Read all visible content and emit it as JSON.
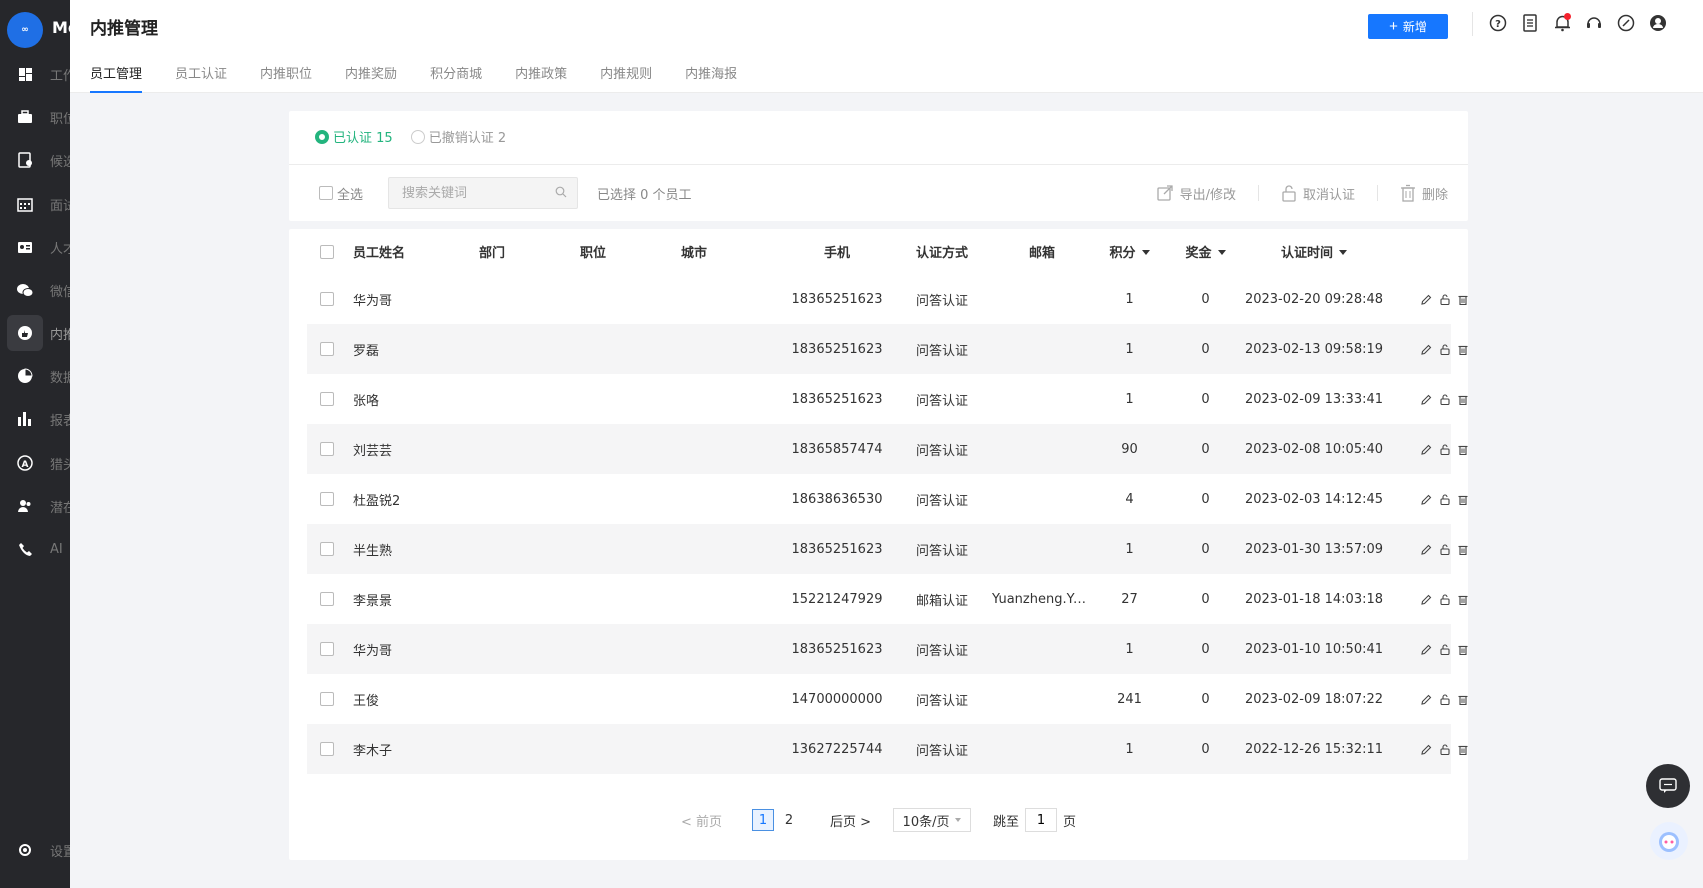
{
  "app": {
    "logo_text": "Mo",
    "logo_mark": "∞",
    "page_title": "内推管理"
  },
  "sidebar": {
    "items": [
      {
        "icon": "dashboard-icon",
        "label": "工作台"
      },
      {
        "icon": "briefcase-icon",
        "label": "职位"
      },
      {
        "icon": "candidate-icon",
        "label": "候选人"
      },
      {
        "icon": "calendar-icon",
        "label": "面试"
      },
      {
        "icon": "idcard-icon",
        "label": "人才库"
      },
      {
        "icon": "wechat-icon",
        "label": "微信"
      },
      {
        "icon": "thumbs-up-icon",
        "label": "内推"
      },
      {
        "icon": "pie-chart-icon",
        "label": "数据"
      },
      {
        "icon": "bar-chart-icon",
        "label": "报表"
      },
      {
        "icon": "headhunter-icon",
        "label": "猎头"
      },
      {
        "icon": "users-icon",
        "label": "潜在"
      },
      {
        "icon": "phone-icon",
        "label": "AI"
      }
    ],
    "settings_label": "设置"
  },
  "header": {
    "add_label": "新增",
    "tabs": [
      "员工管理",
      "员工认证",
      "内推职位",
      "内推奖励",
      "积分商城",
      "内推政策",
      "内推规则",
      "内推海报"
    ]
  },
  "filter": {
    "radio_certified": "已认证 15",
    "radio_revoked": "已撤销认证 2",
    "select_all": "全选",
    "search_placeholder": "搜索关键词",
    "selected_info": "已选择 0 个员工",
    "action_export": "导出/修改",
    "action_cancel": "取消认证",
    "action_delete": "删除"
  },
  "table": {
    "headers": {
      "name": "员工姓名",
      "dept": "部门",
      "position": "职位",
      "city": "城市",
      "phone": "手机",
      "auth": "认证方式",
      "email": "邮箱",
      "points": "积分",
      "bonus": "奖金",
      "time": "认证时间"
    },
    "rows": [
      {
        "name": "华为哥",
        "dept": "",
        "position": "",
        "city": "",
        "phone": "18365251623",
        "auth": "问答认证",
        "email": "",
        "points": "1",
        "bonus": "0",
        "time": "2023-02-20 09:28:48"
      },
      {
        "name": "罗磊",
        "dept": "",
        "position": "",
        "city": "",
        "phone": "18365251623",
        "auth": "问答认证",
        "email": "",
        "points": "1",
        "bonus": "0",
        "time": "2023-02-13 09:58:19"
      },
      {
        "name": "张咯",
        "dept": "",
        "position": "",
        "city": "",
        "phone": "18365251623",
        "auth": "问答认证",
        "email": "",
        "points": "1",
        "bonus": "0",
        "time": "2023-02-09 13:33:41"
      },
      {
        "name": "刘芸芸",
        "dept": "",
        "position": "",
        "city": "",
        "phone": "18365857474",
        "auth": "问答认证",
        "email": "",
        "points": "90",
        "bonus": "0",
        "time": "2023-02-08 10:05:40"
      },
      {
        "name": "杜盈锐2",
        "dept": "",
        "position": "",
        "city": "",
        "phone": "18638636530",
        "auth": "问答认证",
        "email": "",
        "points": "4",
        "bonus": "0",
        "time": "2023-02-03 14:12:45"
      },
      {
        "name": "半生熟",
        "dept": "",
        "position": "",
        "city": "",
        "phone": "18365251623",
        "auth": "问答认证",
        "email": "",
        "points": "1",
        "bonus": "0",
        "time": "2023-01-30 13:57:09"
      },
      {
        "name": "李景景",
        "dept": "",
        "position": "",
        "city": "",
        "phone": "15221247929",
        "auth": "邮箱认证",
        "email": "Yuanzheng.Yu...",
        "points": "27",
        "bonus": "0",
        "time": "2023-01-18 14:03:18"
      },
      {
        "name": "华为哥",
        "dept": "",
        "position": "",
        "city": "",
        "phone": "18365251623",
        "auth": "问答认证",
        "email": "",
        "points": "1",
        "bonus": "0",
        "time": "2023-01-10 10:50:41"
      },
      {
        "name": "王俊",
        "dept": "",
        "position": "",
        "city": "",
        "phone": "14700000000",
        "auth": "问答认证",
        "email": "",
        "points": "241",
        "bonus": "0",
        "time": "2023-02-09 18:07:22"
      },
      {
        "name": "李木子",
        "dept": "",
        "position": "",
        "city": "",
        "phone": "13627225744",
        "auth": "问答认证",
        "email": "",
        "points": "1",
        "bonus": "0",
        "time": "2022-12-26 15:32:11"
      }
    ]
  },
  "pager": {
    "prev": "< 前页",
    "pages": [
      "1",
      "2"
    ],
    "current": "1",
    "next": "后页 >",
    "size": "10条/页",
    "jump_label": "跳至",
    "jump_value": "1",
    "page_unit": "页"
  },
  "colors": {
    "accent": "#1677ff",
    "success": "#23b47e",
    "sidebar_bg": "#26272b"
  }
}
